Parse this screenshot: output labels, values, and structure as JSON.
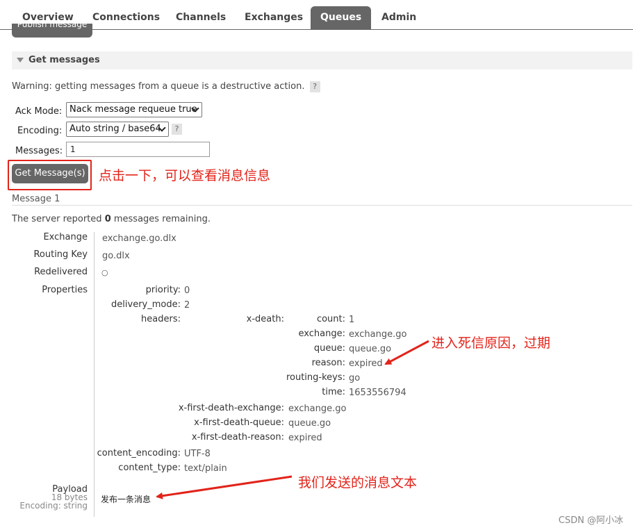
{
  "tabs": [
    "Overview",
    "Connections",
    "Channels",
    "Exchanges",
    "Queues",
    "Admin"
  ],
  "active_tab": "Queues",
  "publish_button": "Publish message",
  "section_title": "Get messages",
  "warning": "Warning: getting messages from a queue is a destructive action.",
  "help_glyph": "?",
  "form": {
    "ack_label": "Ack Mode:",
    "ack_value": "Nack message requeue true",
    "encoding_label": "Encoding:",
    "encoding_value": "Auto string / base64",
    "messages_label": "Messages:",
    "messages_value": "1"
  },
  "get_button": "Get Message(s)",
  "annotations": {
    "click": "点击一下，可以查看消息信息",
    "reason": "进入死信原因，过期",
    "payload": "我们发送的消息文本"
  },
  "message_header": "Message 1",
  "server_report": {
    "prefix": "The server reported ",
    "count": "0",
    "suffix": " messages remaining."
  },
  "fields": {
    "exchange_label": "Exchange",
    "exchange": "exchange.go.dlx",
    "routing_key_label": "Routing Key",
    "routing_key": "go.dlx",
    "redelivered_label": "Redelivered",
    "redelivered": "○",
    "properties_label": "Properties"
  },
  "properties": {
    "priority_k": "priority:",
    "priority": "0",
    "delivery_mode_k": "delivery_mode:",
    "delivery_mode": "2",
    "headers_k": "headers:",
    "xdeath_k": "x-death:",
    "count_k": "count:",
    "count": "1",
    "exchange_k": "exchange:",
    "exchange": "exchange.go",
    "queue_k": "queue:",
    "queue": "queue.go",
    "reason_k": "reason:",
    "reason": "expired",
    "routing_keys_k": "routing-keys:",
    "routing_keys": "go",
    "time_k": "time:",
    "time": "1653556794",
    "xfde_k": "x-first-death-exchange:",
    "xfde": "exchange.go",
    "xfdq_k": "x-first-death-queue:",
    "xfdq": "queue.go",
    "xfdr_k": "x-first-death-reason:",
    "xfdr": "expired",
    "content_encoding_k": "content_encoding:",
    "content_encoding": "UTF-8",
    "content_type_k": "content_type:",
    "content_type": "text/plain"
  },
  "payload": {
    "label": "Payload",
    "size": "18 bytes",
    "encoding": "Encoding: string",
    "text": "发布一条消息"
  },
  "watermark": "CSDN @阿小冰",
  "colors": {
    "tab_active": "#666666",
    "annotation": "#e2231a",
    "button": "#666666"
  }
}
